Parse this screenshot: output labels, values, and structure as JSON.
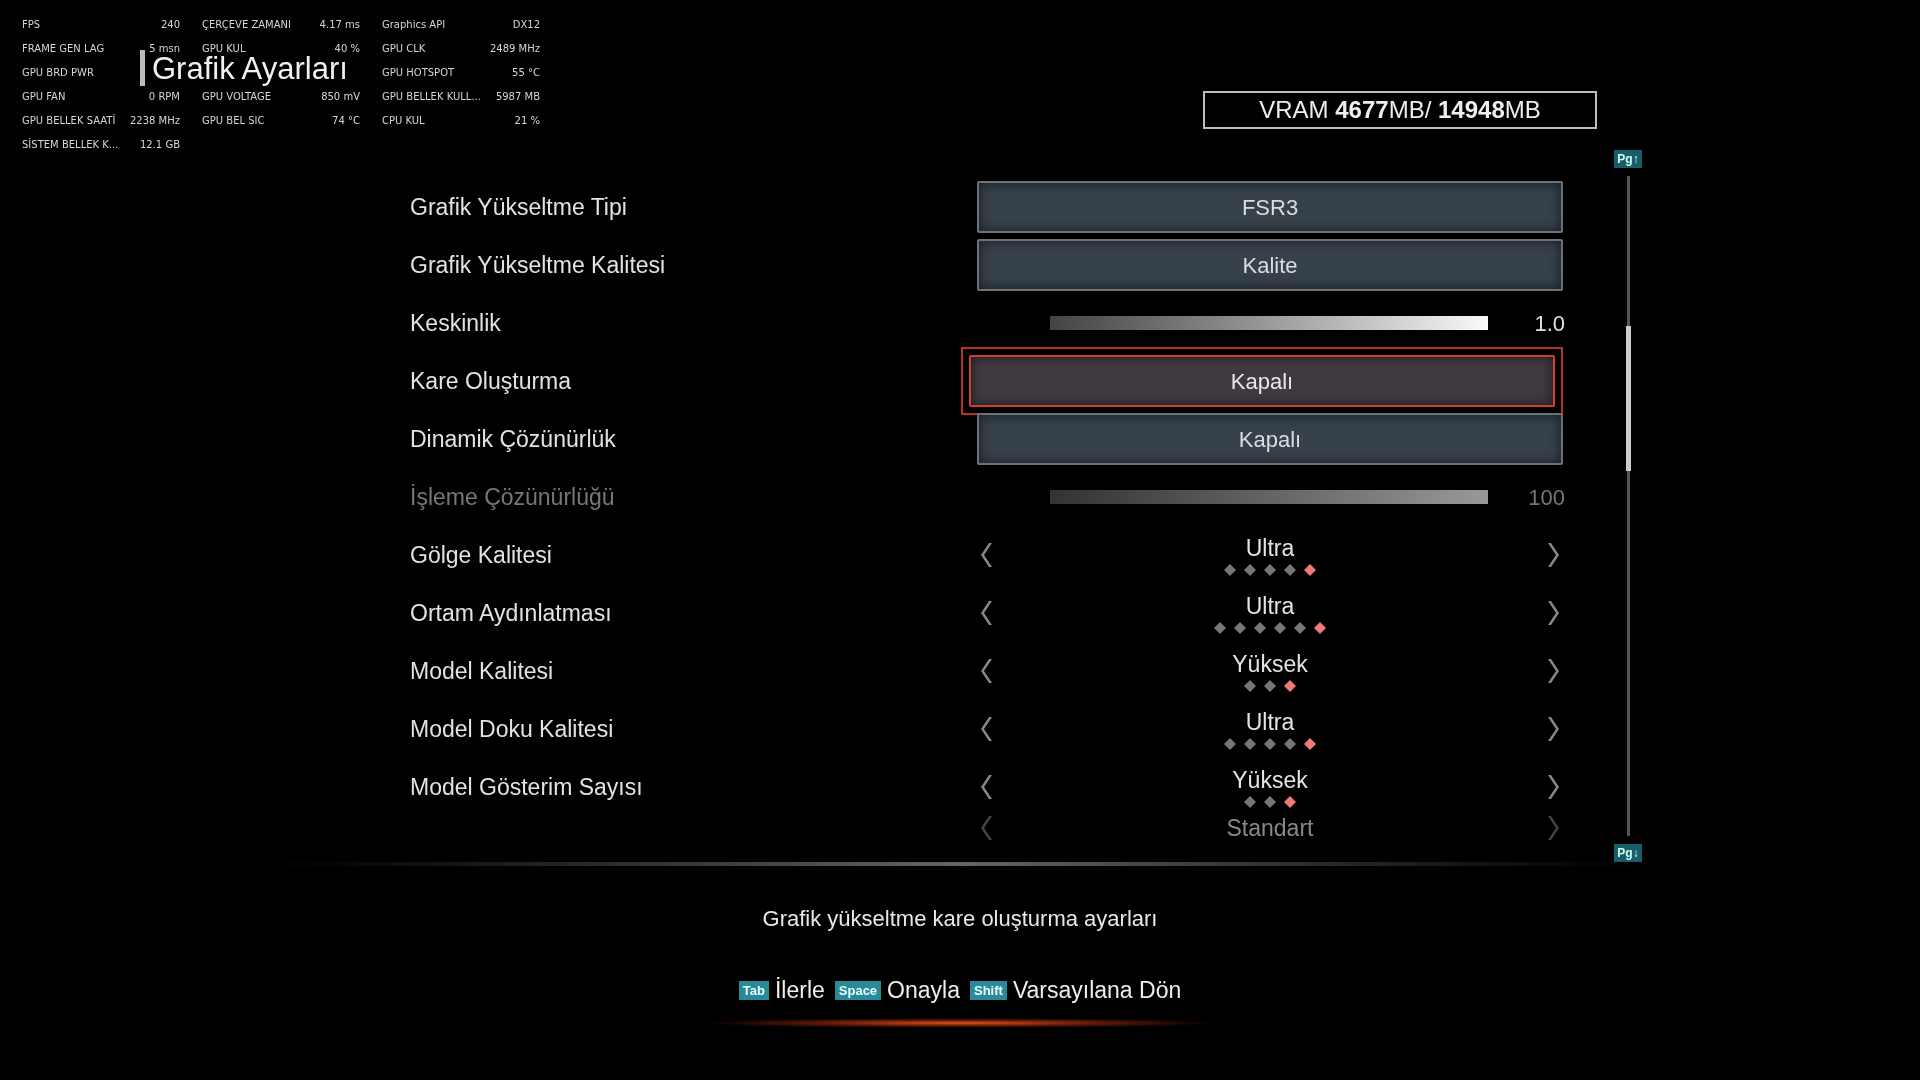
{
  "overlay": {
    "columns": [
      {
        "rows": [
          {
            "label": "FPS",
            "value": "240"
          },
          {
            "label": "FRAME GEN LAG",
            "value": "5 msn"
          },
          {
            "label": "GPU BRD PWR"
          },
          {
            "label": "GPU FAN",
            "value": "0 RPM"
          },
          {
            "label": "GPU BELLEK SAATİ",
            "value": "2238 MHz"
          },
          {
            "label": "SİSTEM BELLEK K...",
            "value": "12.1 GB"
          }
        ]
      },
      {
        "rows": [
          {
            "label": "ÇERÇEVE ZAMANI",
            "value": "4.17 ms"
          },
          {
            "label": "GPU KUL",
            "value": "40 %"
          },
          {},
          {
            "label": "GPU VOLTAGE",
            "value": "850 mV"
          },
          {
            "label": "GPU BEL SIC",
            "value": "74 °C"
          }
        ]
      },
      {
        "rows": [
          {
            "label": "Graphics API",
            "value": "DX12"
          },
          {
            "label": "GPU CLK",
            "value": "2489 MHz"
          },
          {
            "label": "GPU HOTSPOT",
            "value": "55 °C"
          },
          {
            "label": "GPU BELLEK KULL...",
            "value": "5987 MB"
          },
          {
            "label": "CPU KUL",
            "value": "21 %"
          }
        ]
      }
    ]
  },
  "title": "Grafik Ayarları",
  "vram": {
    "label": "VRAM",
    "used": "4677",
    "used_unit": "MB/",
    "total": "14948",
    "total_unit": "MB"
  },
  "page_up": "Pg↑",
  "page_down": "Pg↓",
  "settings": [
    {
      "kind": "button",
      "label": "Grafik Yükseltme Tipi",
      "value": "FSR3",
      "focused": false
    },
    {
      "kind": "button",
      "label": "Grafik Yükseltme Kalitesi",
      "value": "Kalite",
      "focused": false
    },
    {
      "kind": "slider",
      "label": "Keskinlik",
      "value": "1.0",
      "level": 1.0,
      "disabled": false
    },
    {
      "kind": "button",
      "label": "Kare Oluşturma",
      "value": "Kapalı",
      "focused": true
    },
    {
      "kind": "button",
      "label": "Dinamik Çözünürlük",
      "value": "Kapalı",
      "focused": false
    },
    {
      "kind": "slider",
      "label": "İşleme Çözünürlüğü",
      "value": "100",
      "level": 1.0,
      "disabled": true
    },
    {
      "kind": "selector",
      "label": "Gölge Kalitesi",
      "value": "Ultra",
      "dots": [
        {
          "selected": false
        },
        {
          "selected": false
        },
        {
          "selected": false
        },
        {
          "selected": false
        },
        {
          "selected": true
        }
      ]
    },
    {
      "kind": "selector",
      "label": "Ortam Aydınlatması",
      "value": "Ultra",
      "dots": [
        {
          "selected": false
        },
        {
          "selected": false
        },
        {
          "selected": false
        },
        {
          "selected": false
        },
        {
          "selected": false
        },
        {
          "selected": true
        }
      ]
    },
    {
      "kind": "selector",
      "label": "Model Kalitesi",
      "value": "Yüksek",
      "dots": [
        {
          "selected": false
        },
        {
          "selected": false
        },
        {
          "selected": true
        }
      ]
    },
    {
      "kind": "selector",
      "label": "Model Doku Kalitesi",
      "value": "Ultra",
      "dots": [
        {
          "selected": false
        },
        {
          "selected": false
        },
        {
          "selected": false
        },
        {
          "selected": false
        },
        {
          "selected": true
        }
      ]
    },
    {
      "kind": "selector",
      "label": "Model Gösterim Sayısı",
      "value": "Yüksek",
      "dots": [
        {
          "selected": false
        },
        {
          "selected": false
        },
        {
          "selected": true
        }
      ]
    },
    {
      "kind": "selector",
      "value": "Standart",
      "disabled": true
    }
  ],
  "description": "Grafik yükseltme kare oluşturma ayarları",
  "hints": [
    {
      "key": "Tab",
      "action": "İlerle"
    },
    {
      "key": "Space",
      "action": "Onayla"
    },
    {
      "key": "Shift",
      "action": "Varsayılana Dön"
    }
  ]
}
